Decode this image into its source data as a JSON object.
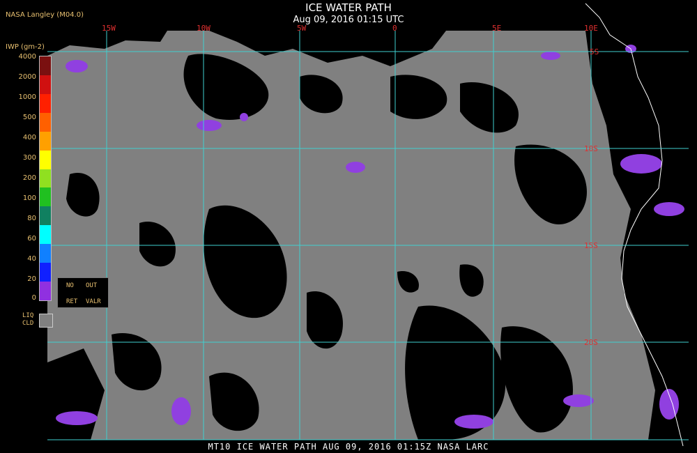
{
  "title": "ICE WATER PATH",
  "subtitle": "Aug 09, 2016 01:15 UTC",
  "credit": "NASA Langley (M04.0)",
  "legend": {
    "title": "IWP (gm-2)",
    "ticks": [
      "4000",
      "2000",
      "1000",
      "500",
      "400",
      "300",
      "200",
      "100",
      "80",
      "60",
      "40",
      "20",
      "0"
    ],
    "colors": [
      "#7a1010",
      "#d01010",
      "#ff2000",
      "#ff6000",
      "#ffa000",
      "#ffff00",
      "#90e020",
      "#20c020",
      "#108060",
      "#00ffff",
      "#1080ff",
      "#1020ff",
      "#9030e0"
    ],
    "no_ret": [
      "NO",
      "RET"
    ],
    "out_valr": [
      "OUT",
      "VALR"
    ],
    "liq_label": [
      "LIQ",
      "CLD"
    ],
    "liq_color": "#808080"
  },
  "map": {
    "lon_labels": [
      "15W",
      "10W",
      "5W",
      "0",
      "5E",
      "10E"
    ],
    "lat_labels": [
      "5S",
      "10S",
      "15S",
      "20S"
    ],
    "grid_color": "#40d0d0",
    "land_color": "#000000",
    "liquid_cloud_color": "#808080",
    "ice_color": "#9040e0"
  },
  "footer": "MT10  ICE WATER PATH   AUG 09, 2016 01:15Z   NASA LARC"
}
